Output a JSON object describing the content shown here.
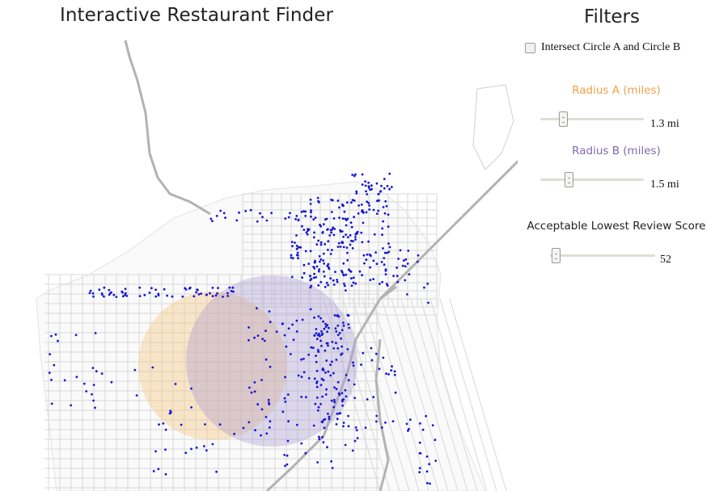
{
  "page": {
    "title": "Interactive Restaurant Finder"
  },
  "filters": {
    "title": "Filters",
    "intersect": {
      "label": "Intersect Circle A and Circle B",
      "checked": false
    },
    "radius_a": {
      "label": "Radius A (miles)",
      "value": "1.3 mi",
      "level": 0.22,
      "color": "#f0a14a"
    },
    "radius_b": {
      "label": "Radius B (miles)",
      "value": "1.5 mi",
      "level": 0.27,
      "color": "#7d6bb0"
    },
    "review_score": {
      "label": "Acceptable Lowest Review Score",
      "value": "52",
      "level": 0.05
    }
  },
  "map": {
    "circle_a_color": "#f7c98a",
    "circle_b_color": "#a89bd0",
    "marker_color": "#1515d6",
    "street_color": "#d8d8d8",
    "highway_color": "#b3b3b3"
  }
}
